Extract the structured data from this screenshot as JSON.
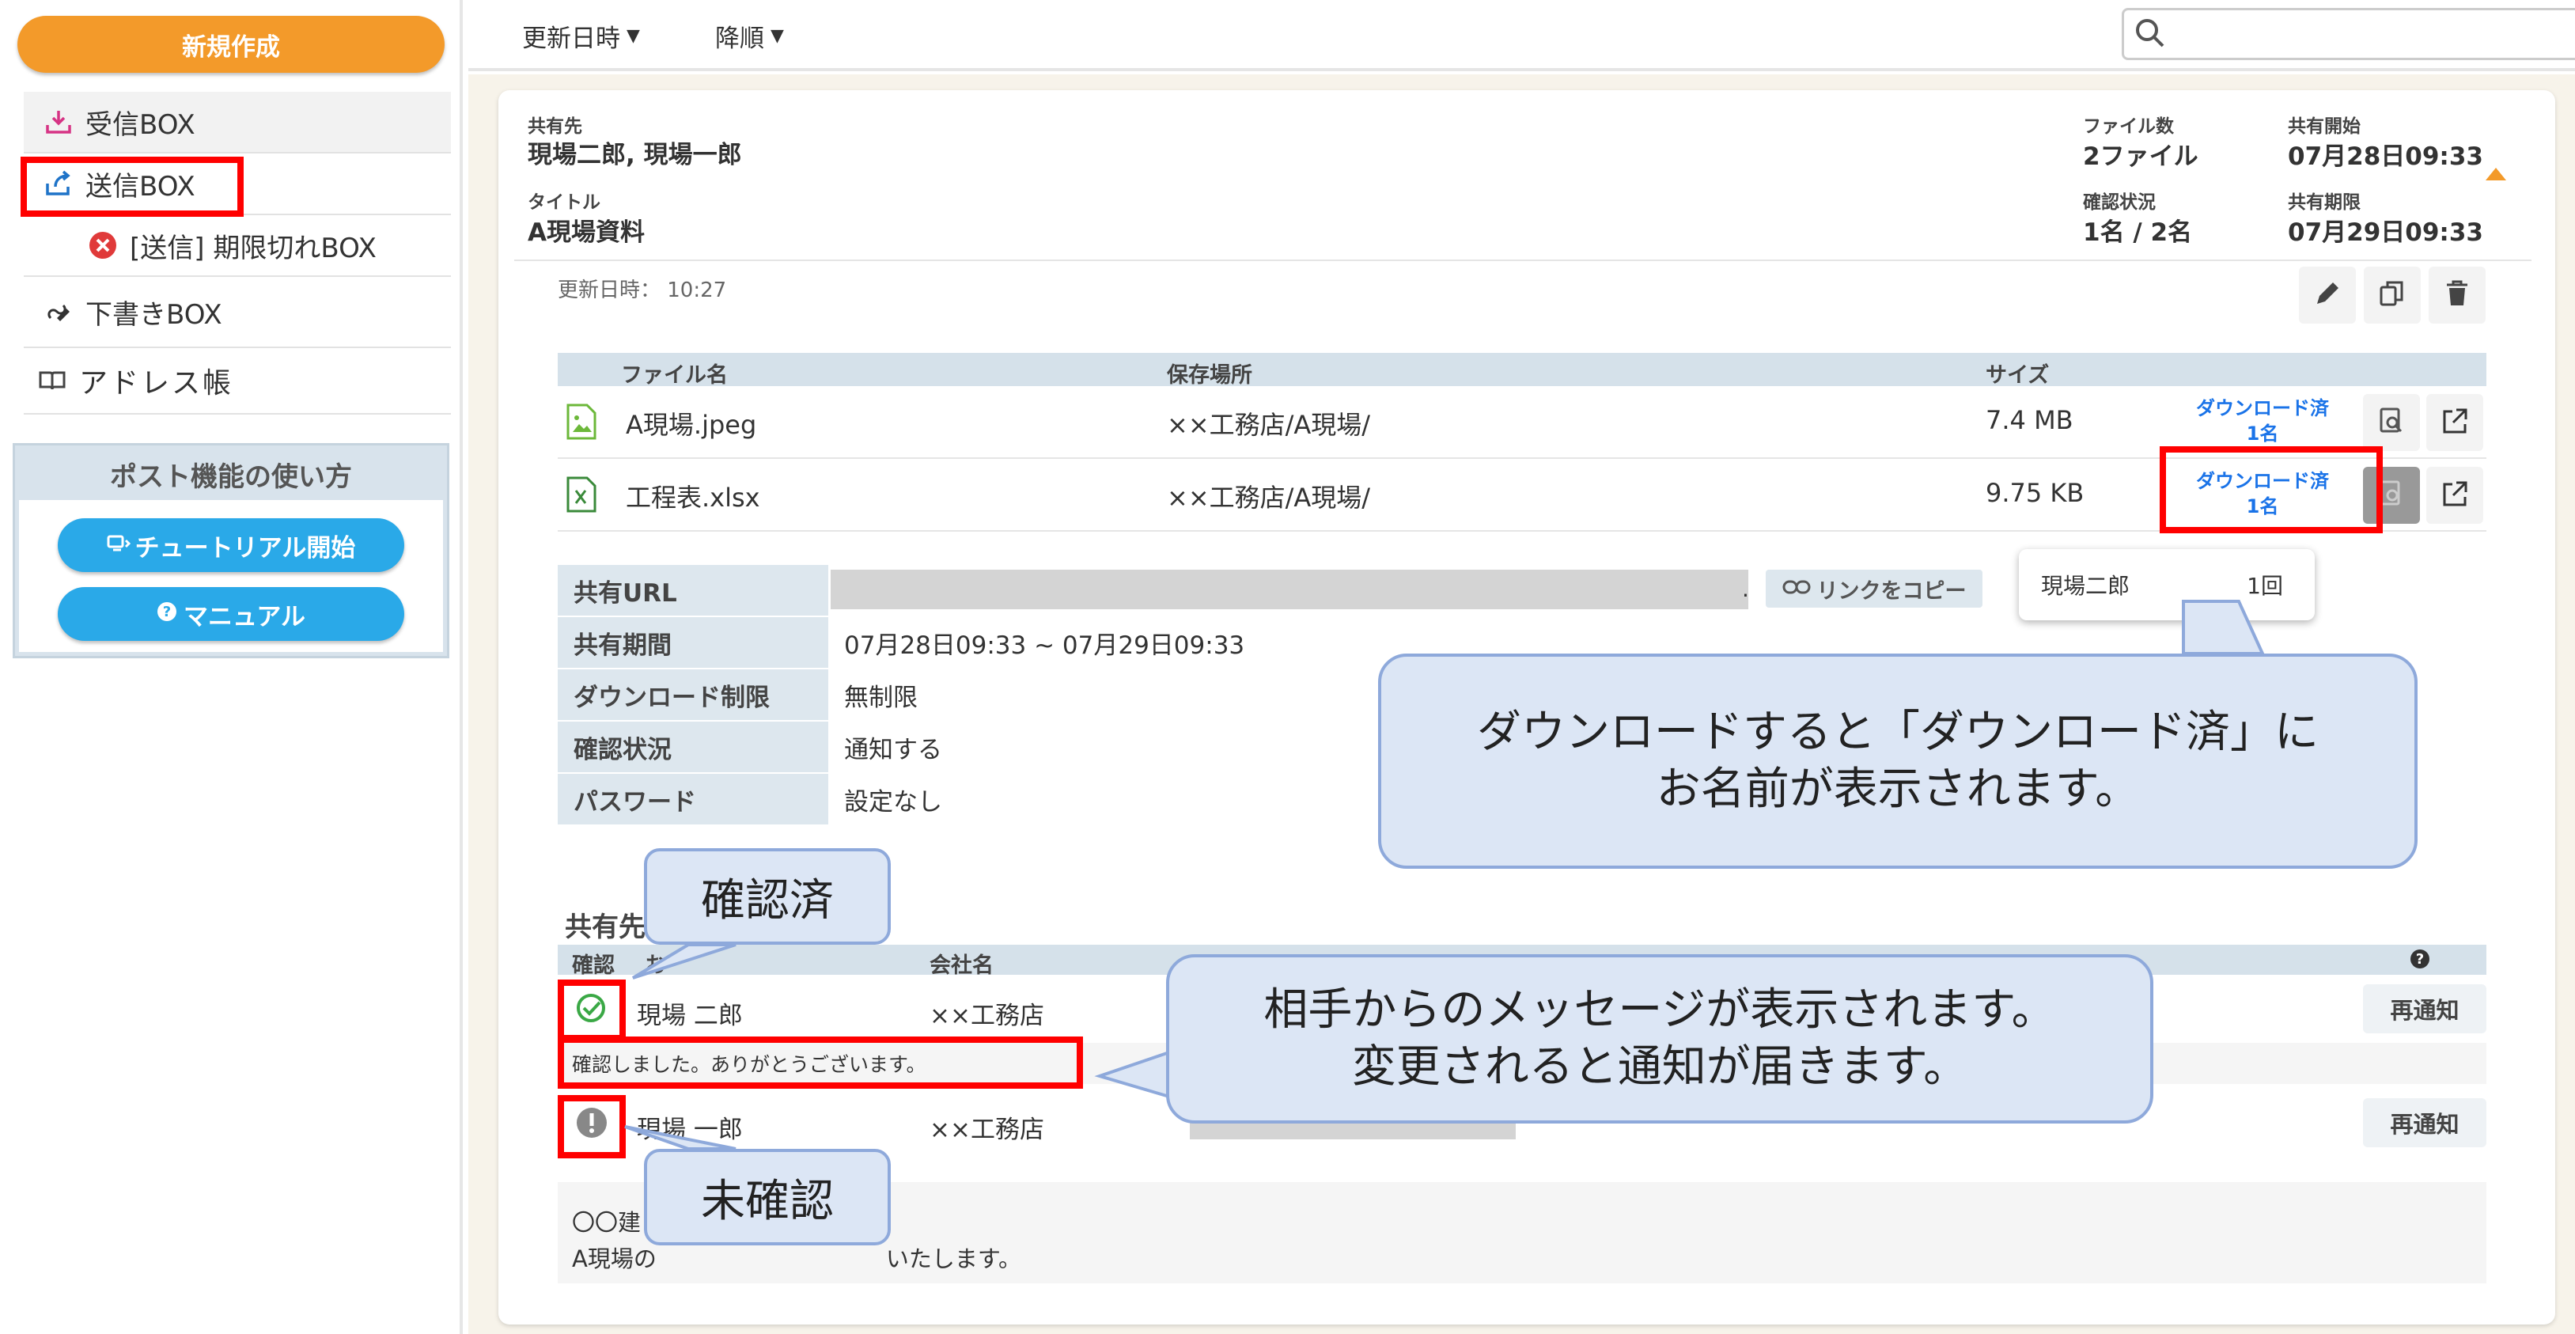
{
  "sidebar": {
    "new_label": "新規作成",
    "items": [
      {
        "label": "受信BOX"
      },
      {
        "label": "送信BOX"
      },
      {
        "label": "[送信] 期限切れBOX"
      },
      {
        "label": "下書きBOX"
      },
      {
        "label": "アドレス帳"
      }
    ],
    "howto": {
      "title": "ポスト機能の使い方",
      "tutorial_label": "チュートリアル開始",
      "manual_label": "マニュアル"
    }
  },
  "toolbar": {
    "sort_field": "更新日時",
    "sort_order": "降順",
    "search_placeholder": ""
  },
  "share": {
    "recipients_label": "共有先",
    "recipients_value": "現場二郎, 現場一郎",
    "title_label": "タイトル",
    "title_value": "A現場資料",
    "file_count_label": "ファイル数",
    "file_count_value": "2ファイル",
    "confirm_label": "確認状況",
    "confirm_value": "1名 / 2名",
    "start_label": "共有開始",
    "start_value": "07月28日09:33",
    "end_label": "共有期限",
    "end_value": "07月29日09:33",
    "updated": "更新日時： 10:27"
  },
  "files": {
    "headers": {
      "name": "ファイル名",
      "location": "保存場所",
      "size": "サイズ"
    },
    "rows": [
      {
        "name": "A現場.jpeg",
        "location": "××工務店/A現場/",
        "size": "7.4 MB",
        "dl_status": "ダウンロード済",
        "dl_count": "1名"
      },
      {
        "name": "工程表.xlsx",
        "location": "××工務店/A現場/",
        "size": "9.75 KB",
        "dl_status": "ダウンロード済",
        "dl_count": "1名"
      }
    ],
    "tooltip": {
      "name": "現場二郎",
      "count": "1回"
    }
  },
  "info": {
    "url_label": "共有URL",
    "url_tail": ".",
    "copy_link_label": "リンクをコピー",
    "period_label": "共有期間",
    "period_value": "07月28日09:33 ~ 07月29日09:33",
    "limit_label": "ダウンロード制限",
    "limit_value": "無制限",
    "confirm_label": "確認状況",
    "confirm_value": "通知する",
    "password_label": "パスワード",
    "password_value": "設定なし"
  },
  "recipients": {
    "title": "共有先",
    "headers": {
      "confirm": "確認",
      "name": "お",
      "company": "会社名"
    },
    "rows": [
      {
        "name": "現場 二郎",
        "company": "××工務店",
        "renotify": "再通知",
        "message": "確認しました。ありがとうございます。"
      },
      {
        "name": "現場 一郎",
        "company": "××工務店",
        "renotify": "再通知"
      }
    ],
    "note_line1": "〇〇建",
    "note_line2": "A現場の　　　　　　　　　　いたします。"
  },
  "callouts": {
    "download_line1": "ダウンロードすると「ダウンロード済」に",
    "download_line2": "お名前が表示されます。",
    "message_line1": "相手からのメッセージが表示されます。",
    "message_line2": "変更されると通知が届きます。",
    "confirmed": "確認済",
    "unconfirmed": "未確認"
  },
  "colors": {
    "accent_orange": "#f39a2a",
    "accent_blue": "#2aa9e8",
    "highlight_red": "#ff0000",
    "callout_fill": "#dce6f5",
    "confirmed_green": "#3aa845"
  }
}
